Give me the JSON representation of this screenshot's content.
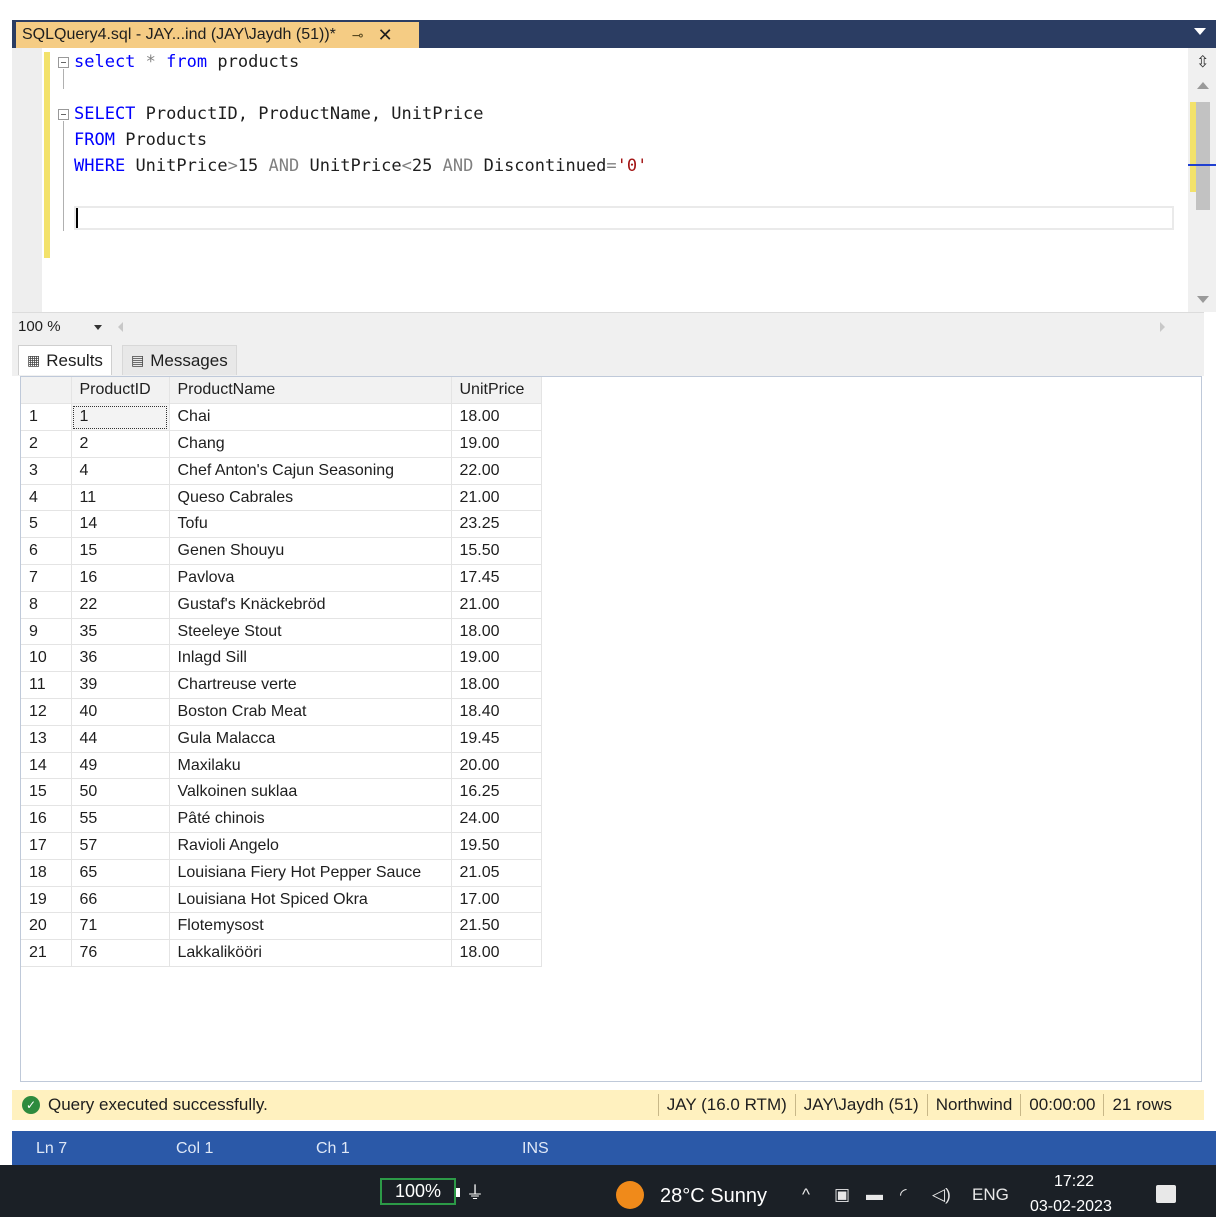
{
  "tab": {
    "title": "SQLQuery4.sql - JAY...ind (JAY\\Jaydh (51))*",
    "pin_glyph": "⊸",
    "close_glyph": "✕"
  },
  "editor": {
    "line1": {
      "kw1": "select",
      "op1": "*",
      "kw2": "from",
      "id1": "products"
    },
    "line3": {
      "kw1": "SELECT",
      "id1": "ProductID, ProductName, UnitPrice"
    },
    "line4": {
      "kw1": "FROM",
      "id1": "Products"
    },
    "line5": {
      "kw1": "WHERE",
      "id1": "UnitPrice",
      "op1": ">",
      "id2": "15",
      "kw2": "AND",
      "id3": "UnitPrice",
      "op2": "<",
      "id4": "25",
      "kw3": "AND",
      "id5": "Discontinued",
      "op3": "=",
      "str1": "'0'"
    }
  },
  "zoom": {
    "value": "100 %"
  },
  "result_tabs": {
    "results": "Results",
    "messages": "Messages"
  },
  "grid": {
    "columns": [
      "ProductID",
      "ProductName",
      "UnitPrice"
    ],
    "rows": [
      [
        "1",
        "1",
        "Chai",
        "18.00"
      ],
      [
        "2",
        "2",
        "Chang",
        "19.00"
      ],
      [
        "3",
        "4",
        "Chef Anton's Cajun Seasoning",
        "22.00"
      ],
      [
        "4",
        "11",
        "Queso Cabrales",
        "21.00"
      ],
      [
        "5",
        "14",
        "Tofu",
        "23.25"
      ],
      [
        "6",
        "15",
        "Genen Shouyu",
        "15.50"
      ],
      [
        "7",
        "16",
        "Pavlova",
        "17.45"
      ],
      [
        "8",
        "22",
        "Gustaf's Knäckebröd",
        "21.00"
      ],
      [
        "9",
        "35",
        "Steeleye Stout",
        "18.00"
      ],
      [
        "10",
        "36",
        "Inlagd Sill",
        "19.00"
      ],
      [
        "11",
        "39",
        "Chartreuse verte",
        "18.00"
      ],
      [
        "12",
        "40",
        "Boston Crab Meat",
        "18.40"
      ],
      [
        "13",
        "44",
        "Gula Malacca",
        "19.45"
      ],
      [
        "14",
        "49",
        "Maxilaku",
        "20.00"
      ],
      [
        "15",
        "50",
        "Valkoinen suklaa",
        "16.25"
      ],
      [
        "16",
        "55",
        "Pâté chinois",
        "24.00"
      ],
      [
        "17",
        "57",
        "Ravioli Angelo",
        "19.50"
      ],
      [
        "18",
        "65",
        "Louisiana Fiery Hot Pepper Sauce",
        "21.05"
      ],
      [
        "19",
        "66",
        "Louisiana Hot Spiced Okra",
        "17.00"
      ],
      [
        "20",
        "71",
        "Flotemysost",
        "21.50"
      ],
      [
        "21",
        "76",
        "Lakkalikööri",
        "18.00"
      ]
    ]
  },
  "status": {
    "message": "Query executed successfully.",
    "server": "JAY (16.0 RTM)",
    "user": "JAY\\Jaydh (51)",
    "database": "Northwind",
    "elapsed": "00:00:00",
    "rows": "21 rows"
  },
  "app_status": {
    "ln": "Ln 7",
    "col": "Col 1",
    "ch": "Ch 1",
    "mode": "INS"
  },
  "taskbar": {
    "battery": "100%",
    "weather": "28°C  Sunny",
    "lang": "ENG",
    "time": "17:22",
    "date": "03-02-2023"
  },
  "colors": {
    "tab_active": "#f5cc84",
    "tabbar": "#2b3d63",
    "keyword": "#0000ff",
    "string": "#a31515",
    "status_bg": "#fff1bf",
    "app_status": "#2b59a8",
    "taskbar": "#1b2026"
  }
}
